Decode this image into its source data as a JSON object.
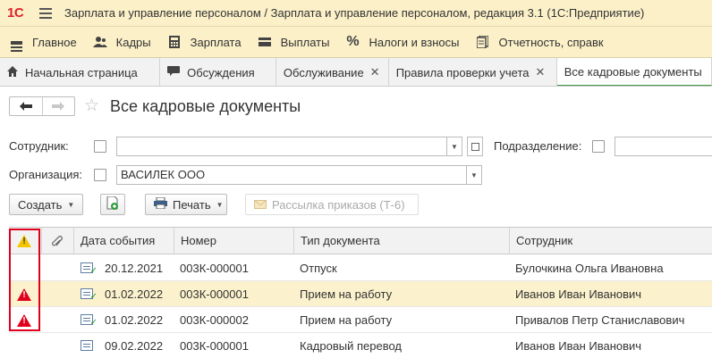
{
  "app": {
    "logo": "1С",
    "title": "Зарплата и управление персоналом / Зарплата и управление персоналом, редакция 3.1  (1С:Предприятие)"
  },
  "menu": [
    {
      "label": "Главное",
      "icon": "menu-bars-icon"
    },
    {
      "label": "Кадры",
      "icon": "people-icon"
    },
    {
      "label": "Зарплата",
      "icon": "calculator-icon"
    },
    {
      "label": "Выплаты",
      "icon": "wallet-icon"
    },
    {
      "label": "Налоги и взносы",
      "icon": "percent-icon"
    },
    {
      "label": "Отчетность, справк",
      "icon": "reports-icon"
    }
  ],
  "tabs": [
    {
      "label": "Начальная страница",
      "icon": "home-icon",
      "closable": false
    },
    {
      "label": "Обсуждения",
      "icon": "chat-icon",
      "closable": false
    },
    {
      "label": "Обслуживание",
      "closable": true
    },
    {
      "label": "Правила проверки учета",
      "closable": true
    },
    {
      "label": "Все кадровые документы",
      "closable": false,
      "active": true
    }
  ],
  "page": {
    "title": "Все кадровые документы"
  },
  "filters": {
    "employee_label": "Сотрудник:",
    "employee_value": "",
    "department_label": "Подразделение:",
    "department_value": "",
    "organization_label": "Организация:",
    "organization_value": "ВАСИЛЕК ООО"
  },
  "toolbar": {
    "create_label": "Создать",
    "print_label": "Печать",
    "mailing_label": "Рассылка приказов (Т-6)"
  },
  "table": {
    "columns": [
      "Дата события",
      "Номер",
      "Тип документа",
      "Сотрудник"
    ],
    "rows": [
      {
        "warning": false,
        "date": "20.12.2021",
        "number": "003К-000001",
        "type": "Отпуск",
        "employee": "Булочкина Ольга Ивановна",
        "posted": true,
        "selected": false
      },
      {
        "warning": true,
        "date": "01.02.2022",
        "number": "003К-000001",
        "type": "Прием на работу",
        "employee": "Иванов Иван Иванович",
        "posted": true,
        "selected": true
      },
      {
        "warning": true,
        "date": "01.02.2022",
        "number": "003К-000002",
        "type": "Прием на работу",
        "employee": "Привалов Петр Станиславович",
        "posted": true,
        "selected": false
      },
      {
        "warning": false,
        "date": "09.02.2022",
        "number": "003К-000001",
        "type": "Кадровый перевод",
        "employee": "Иванов Иван Иванович",
        "posted": false,
        "selected": false
      }
    ]
  },
  "colors": {
    "brand_red": "#d9232a",
    "header_bg": "#fbf0c8",
    "selected_row": "#fbf2cd",
    "warning_red": "#e0001b",
    "warning_yellow": "#f5c400",
    "active_tab_accent": "#3d9a46"
  }
}
